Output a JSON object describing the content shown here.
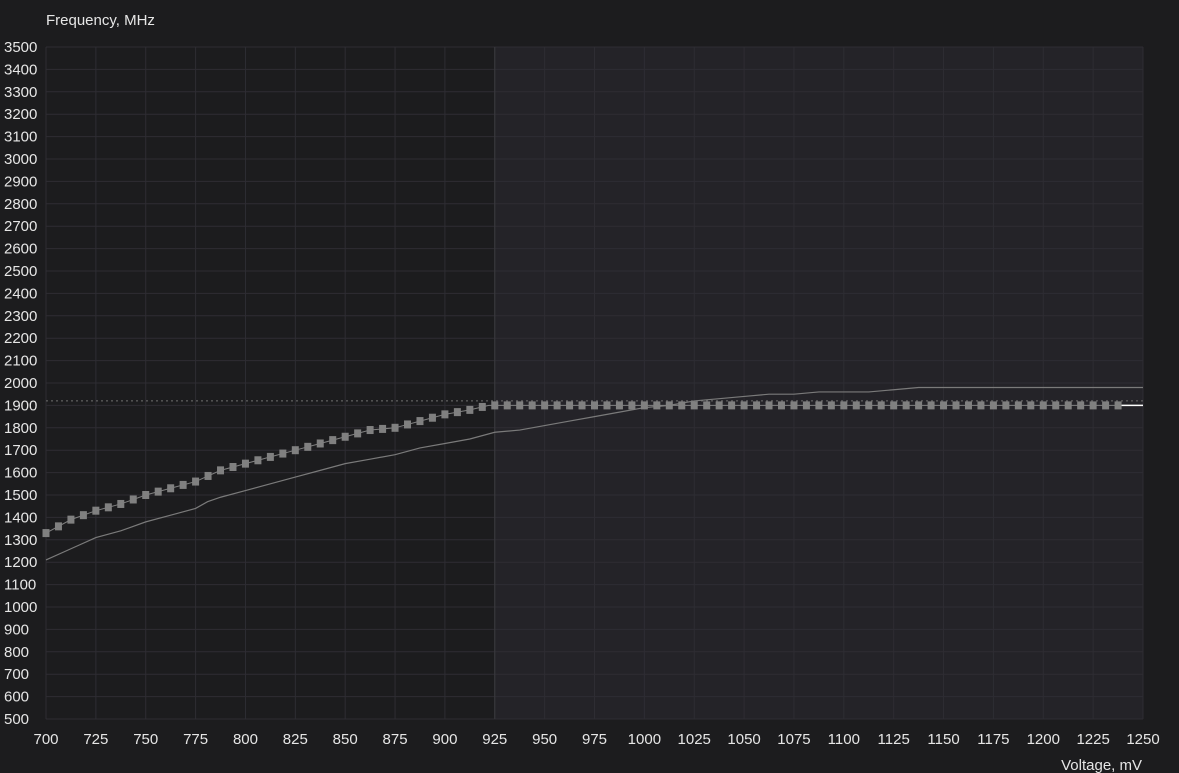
{
  "chart_data": {
    "type": "line",
    "title": "",
    "ylabel": "Frequency, MHz",
    "xlabel": "Voltage, mV",
    "xlim": [
      700,
      1250
    ],
    "ylim": [
      500,
      3500
    ],
    "x_ticks": [
      "700",
      "725",
      "750",
      "775",
      "800",
      "825",
      "850",
      "875",
      "900",
      "925",
      "950",
      "975",
      "1000",
      "1025",
      "1050",
      "1075",
      "1100",
      "1125",
      "1150",
      "1175",
      "1200",
      "1225",
      "1250"
    ],
    "y_ticks": [
      "3500",
      "3400",
      "3300",
      "3200",
      "3100",
      "3000",
      "2900",
      "2800",
      "2700",
      "2600",
      "2500",
      "2400",
      "2300",
      "2200",
      "2100",
      "2000",
      "1900",
      "1800",
      "1700",
      "1600",
      "1500",
      "1400",
      "1300",
      "1200",
      "1100",
      "1000",
      "900",
      "800",
      "700",
      "600",
      "500"
    ],
    "grid": true,
    "selected_point": {
      "x": 925,
      "y": 1920
    },
    "series": [
      {
        "marker": "square",
        "x_step": 6.25,
        "x_start": 700,
        "x_end": 1237.5,
        "points": [
          [
            700,
            1330
          ],
          [
            712.5,
            1390
          ],
          [
            725,
            1430
          ],
          [
            737.5,
            1460
          ],
          [
            750,
            1500
          ],
          [
            762.5,
            1530
          ],
          [
            775,
            1560
          ],
          [
            787.5,
            1610
          ],
          [
            800,
            1640
          ],
          [
            812.5,
            1670
          ],
          [
            825,
            1700
          ],
          [
            837.5,
            1730
          ],
          [
            850,
            1760
          ],
          [
            862.5,
            1790
          ],
          [
            875,
            1800
          ],
          [
            887.5,
            1830
          ],
          [
            900,
            1860
          ],
          [
            912.5,
            1880
          ],
          [
            922,
            1900
          ],
          [
            1237.5,
            1900
          ]
        ]
      },
      {
        "marker": "none",
        "points": [
          [
            700,
            1210
          ],
          [
            712.5,
            1260
          ],
          [
            725,
            1310
          ],
          [
            737.5,
            1340
          ],
          [
            750,
            1380
          ],
          [
            762.5,
            1410
          ],
          [
            775,
            1440
          ],
          [
            781,
            1470
          ],
          [
            787.5,
            1490
          ],
          [
            800,
            1520
          ],
          [
            812.5,
            1550
          ],
          [
            825,
            1580
          ],
          [
            837.5,
            1610
          ],
          [
            850,
            1640
          ],
          [
            862.5,
            1660
          ],
          [
            875,
            1680
          ],
          [
            887.5,
            1710
          ],
          [
            900,
            1730
          ],
          [
            912.5,
            1750
          ],
          [
            925,
            1780
          ],
          [
            937.5,
            1790
          ],
          [
            950,
            1810
          ],
          [
            962.5,
            1830
          ],
          [
            975,
            1850
          ],
          [
            987.5,
            1870
          ],
          [
            1000,
            1890
          ],
          [
            1012.5,
            1900
          ],
          [
            1025,
            1920
          ],
          [
            1037.5,
            1930
          ],
          [
            1050,
            1940
          ],
          [
            1062.5,
            1950
          ],
          [
            1075,
            1950
          ],
          [
            1087.5,
            1960
          ],
          [
            1100,
            1960
          ],
          [
            1112.5,
            1960
          ],
          [
            1125,
            1970
          ],
          [
            1137.5,
            1980
          ],
          [
            1150,
            1980
          ],
          [
            1200,
            1980
          ],
          [
            1250,
            1980
          ]
        ]
      },
      {
        "marker": "none",
        "points": [
          [
            1237.5,
            1900
          ],
          [
            1250,
            1900
          ]
        ]
      }
    ]
  },
  "colors": {
    "background": "#1c1c1e",
    "plot_left": "#1c1c1e",
    "plot_right": "#242328",
    "grid": "#2e2d33",
    "text": "#e6e6e6",
    "marker": "#808080",
    "curve_line": "#7a7a7a",
    "dotted_line": "#6f6f6f",
    "white_tail": "#ffffff"
  }
}
